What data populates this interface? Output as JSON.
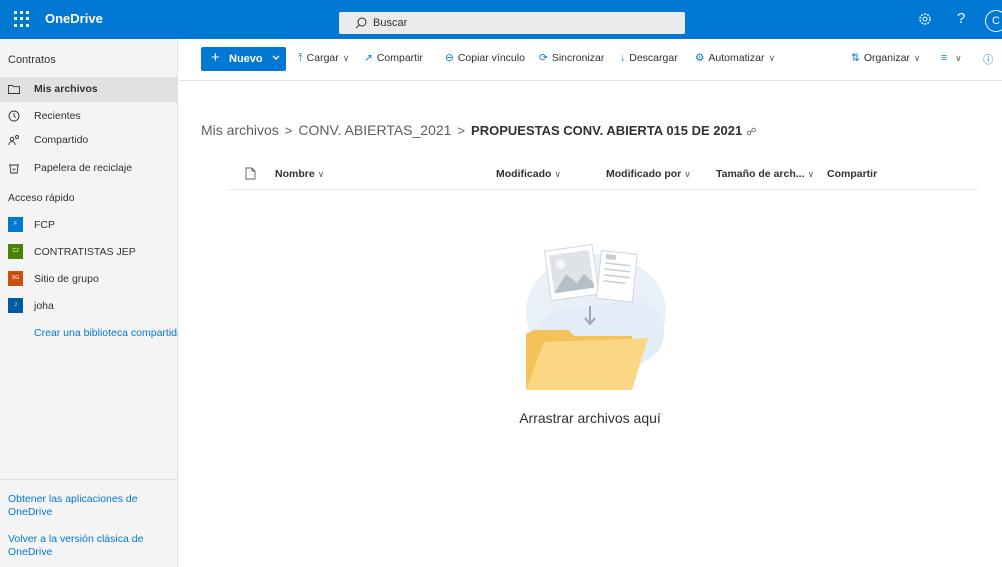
{
  "header": {
    "app_name": "OneDrive",
    "search_placeholder": "Buscar",
    "avatar_initial": "C",
    "accent": "#0078d4"
  },
  "leftnav": {
    "title": "Contratos",
    "items": [
      {
        "label": "Mis archivos",
        "icon": "folder-icon",
        "selected": true
      },
      {
        "label": "Recientes",
        "icon": "clock-icon"
      },
      {
        "label": "Compartido",
        "icon": "people-icon"
      },
      {
        "label": "Papelera de reciclaje",
        "icon": "recycle-bin-icon"
      }
    ],
    "quick_access_title": "Acceso rápido",
    "quick_access": [
      {
        "label": "FCP",
        "badge": "F",
        "color": "#0078d4"
      },
      {
        "label": "CONTRATISTAS JEP",
        "badge": "CJ",
        "color": "#498205"
      },
      {
        "label": "Sitio de grupo",
        "badge": "SG",
        "color": "#ca5010"
      },
      {
        "label": "joha",
        "badge": "J",
        "color": "#005a9e"
      }
    ],
    "create_library": "Crear una biblioteca compartida",
    "footer_links": [
      "Obtener las aplicaciones de OneDrive",
      "Volver a la versión clásica de OneDrive"
    ]
  },
  "commandbar": {
    "new_label": "Nuevo",
    "upload_label": "Cargar",
    "share_label": "Compartir",
    "copy_link_label": "Copiar vínculo",
    "sync_label": "Sincronizar",
    "download_label": "Descargar",
    "automate_label": "Automatizar",
    "sort_label": "Organizar"
  },
  "breadcrumb": {
    "items": [
      "Mis archivos",
      "CONV. ABIERTAS_2021"
    ],
    "current": "PROPUESTAS CONV. ABIERTA 015 DE 2021"
  },
  "columns": {
    "name": "Nombre",
    "modified": "Modificado",
    "modified_by": "Modificado por",
    "size": "Tamaño de arch...",
    "sharing": "Compartir"
  },
  "empty_state": {
    "message": "Arrastrar archivos aquí"
  }
}
